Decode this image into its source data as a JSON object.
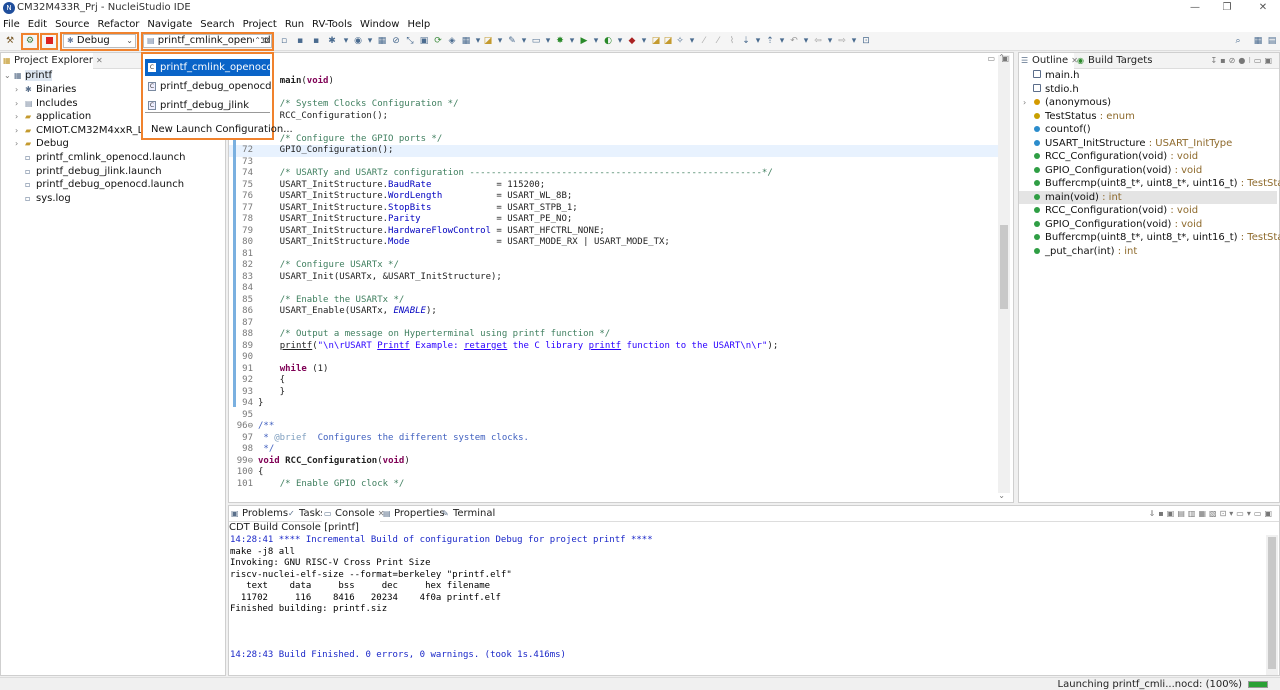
{
  "window": {
    "title": "CM32M433R_Prj - NucleiStudio IDE",
    "logo_text": "N",
    "minimize": "—",
    "restore": "❐",
    "close": "✕"
  },
  "menu": [
    "File",
    "Edit",
    "Source",
    "Refactor",
    "Navigate",
    "Search",
    "Project",
    "Run",
    "RV-Tools",
    "Window",
    "Help"
  ],
  "toolbar": {
    "launch_mode": "Debug",
    "launch_config": "printf_cmlink_openocd"
  },
  "launch_dropdown": {
    "items": [
      "printf_cmlink_openocd",
      "printf_debug_openocd",
      "printf_debug_jlink"
    ],
    "new_config": "New Launch Configuration..."
  },
  "project_explorer": {
    "tab": "Project Explorer",
    "root": "printf",
    "children": [
      {
        "label": "Binaries",
        "kind": "binaries",
        "expandable": true
      },
      {
        "label": "Includes",
        "kind": "includes",
        "expandable": true
      },
      {
        "label": "application",
        "kind": "folder",
        "expandable": true
      },
      {
        "label": "CMIOT.CM32M4xxR_Library",
        "kind": "folder",
        "expandable": true
      },
      {
        "label": "Debug",
        "kind": "folder",
        "expandable": true
      },
      {
        "label": "printf_cmlink_openocd.launch",
        "kind": "file",
        "expandable": false
      },
      {
        "label": "printf_debug_jlink.launch",
        "kind": "file",
        "expandable": false
      },
      {
        "label": "printf_debug_openocd.launch",
        "kind": "file",
        "expandable": false
      },
      {
        "label": "sys.log",
        "kind": "file",
        "expandable": false
      }
    ]
  },
  "editor": {
    "lines": [
      {
        "n": "",
        "html": "<span class=\"kw\">int</span> <b>main</b>(<span class=\"kw\">void</span>)"
      },
      {
        "n": "",
        "html": ""
      },
      {
        "n": "",
        "html": "    <span class=\"cm\">/* System Clocks Configuration */</span>"
      },
      {
        "n": "",
        "html": "    RCC_Configuration();"
      },
      {
        "n": "",
        "html": ""
      },
      {
        "n": "",
        "html": "    <span class=\"cm\">/* Configure the GPIO ports */</span>"
      },
      {
        "n": "72",
        "html": "    GPIO_Configuration();",
        "cur": true
      },
      {
        "n": "73",
        "html": ""
      },
      {
        "n": "74",
        "html": "    <span class=\"cm\">/* USARTy and USARTz configuration ------------------------------------------------------*/</span>"
      },
      {
        "n": "75",
        "html": "    USART_InitStructure.<span class=\"fld\">BaudRate</span>            = 115200;"
      },
      {
        "n": "76",
        "html": "    USART_InitStructure.<span class=\"fld\">WordLength</span>          = USART_WL_8B;"
      },
      {
        "n": "77",
        "html": "    USART_InitStructure.<span class=\"fld\">StopBits</span>            = USART_STPB_1;"
      },
      {
        "n": "78",
        "html": "    USART_InitStructure.<span class=\"fld\">Parity</span>              = USART_PE_NO;"
      },
      {
        "n": "79",
        "html": "    USART_InitStructure.<span class=\"fld\">HardwareFlowControl</span> = USART_HFCTRL_NONE;"
      },
      {
        "n": "80",
        "html": "    USART_InitStructure.<span class=\"fld\">Mode</span>                = USART_MODE_RX | USART_MODE_TX;"
      },
      {
        "n": "81",
        "html": ""
      },
      {
        "n": "82",
        "html": "    <span class=\"cm\">/* Configure USARTx */</span>"
      },
      {
        "n": "83",
        "html": "    USART_Init(USARTx, &amp;USART_InitStructure);"
      },
      {
        "n": "84",
        "html": ""
      },
      {
        "n": "85",
        "html": "    <span class=\"cm\">/* Enable the USARTx */</span>"
      },
      {
        "n": "86",
        "html": "    USART_Enable(USARTx, <span class=\"it\">ENABLE</span>);"
      },
      {
        "n": "87",
        "html": ""
      },
      {
        "n": "88",
        "html": "    <span class=\"cm\">/* Output a message on Hyperterminal using printf function */</span>"
      },
      {
        "n": "89",
        "html": "    <span class=\"ul\">printf</span>(<span class=\"st\">\"\\n\\rUSART <span class=\"ul\">Printf</span> Example: <span class=\"ul\">retarget</span> the C library <span class=\"ul\">printf</span> function to the USART\\n\\r\"</span>);"
      },
      {
        "n": "90",
        "html": ""
      },
      {
        "n": "91",
        "html": "    <span class=\"kw\">while</span> (1)"
      },
      {
        "n": "92",
        "html": "    {"
      },
      {
        "n": "93",
        "html": "    }"
      },
      {
        "n": "94",
        "html": "}"
      },
      {
        "n": "95",
        "html": ""
      },
      {
        "n": "96⊖",
        "html": "<span class=\"doc\">/**</span>"
      },
      {
        "n": "97",
        "html": "<span class=\"doc\"> * <span style=\"color:#7f9fbf\">@brief</span>  Configures the different system clocks.</span>"
      },
      {
        "n": "98",
        "html": "<span class=\"doc\"> */</span>"
      },
      {
        "n": "99⊖",
        "html": "<span class=\"kw\">void</span> <b>RCC_Configuration</b>(<span class=\"kw\">void</span>)"
      },
      {
        "n": "100",
        "html": "{"
      },
      {
        "n": "101",
        "html": "    <span class=\"cm\">/* Enable GPIO clock */</span>"
      }
    ]
  },
  "outline": {
    "tabs": [
      "Outline",
      "Build Targets"
    ],
    "items": [
      {
        "label": "main.h",
        "type": "",
        "kind": "inc"
      },
      {
        "label": "stdio.h",
        "type": "",
        "kind": "inc"
      },
      {
        "label": "(anonymous)",
        "type": "",
        "kind": "struct",
        "expandable": true
      },
      {
        "label": "TestStatus",
        "type": " : enum",
        "kind": "enum"
      },
      {
        "label": "countof()",
        "type": "",
        "kind": "var"
      },
      {
        "label": "USART_InitStructure",
        "type": " : USART_InitType",
        "kind": "var"
      },
      {
        "label": "RCC_Configuration(void)",
        "type": " : void",
        "kind": "fn"
      },
      {
        "label": "GPIO_Configuration(void)",
        "type": " : void",
        "kind": "fn"
      },
      {
        "label": "Buffercmp(uint8_t*, uint8_t*, uint16_t)",
        "type": " : TestStatus",
        "kind": "fn"
      },
      {
        "label": "main(void)",
        "type": " : int",
        "kind": "fn",
        "selected": true
      },
      {
        "label": "RCC_Configuration(void)",
        "type": " : void",
        "kind": "fn"
      },
      {
        "label": "GPIO_Configuration(void)",
        "type": " : void",
        "kind": "fn"
      },
      {
        "label": "Buffercmp(uint8_t*, uint8_t*, uint16_t)",
        "type": " : TestStatus",
        "kind": "fn"
      },
      {
        "label": "_put_char(int)",
        "type": " : int",
        "kind": "fn"
      }
    ]
  },
  "bottom": {
    "tabs": [
      "Problems",
      "Tasks",
      "Console",
      "Properties",
      "Terminal"
    ],
    "console_title": "CDT Build Console [printf]",
    "lines": [
      {
        "text": "14:28:41 **** Incremental Build of configuration Debug for project printf ****",
        "blue": true
      },
      {
        "text": "make -j8 all"
      },
      {
        "text": "Invoking: GNU RISC-V Cross Print Size"
      },
      {
        "text": "riscv-nuclei-elf-size --format=berkeley \"printf.elf\""
      },
      {
        "text": "   text    data     bss     dec     hex filename"
      },
      {
        "text": "  11702     116    8416   20234    4f0a printf.elf"
      },
      {
        "text": "Finished building: printf.siz"
      },
      {
        "text": ""
      },
      {
        "text": ""
      },
      {
        "text": ""
      },
      {
        "text": "14:28:43 Build Finished. 0 errors, 0 warnings. (took 1s.416ms)",
        "blue": true
      }
    ]
  },
  "status": {
    "text": "Launching printf_cmli...nocd: (100%)",
    "progress": 1.0
  }
}
